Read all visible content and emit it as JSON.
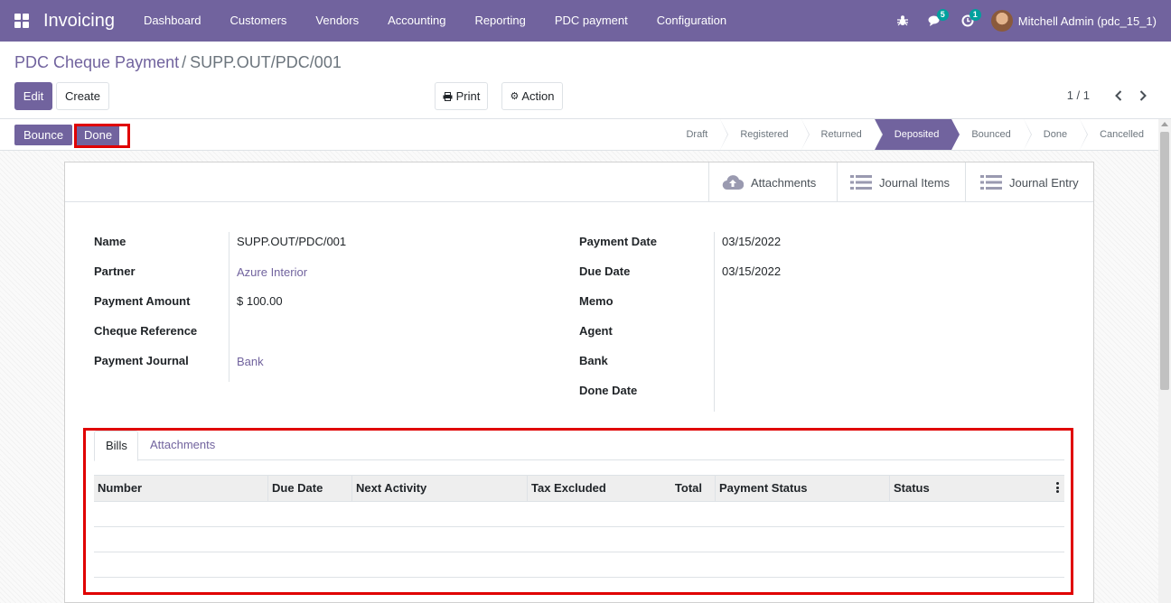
{
  "navbar": {
    "app_name": "Invoicing",
    "menu": [
      "Dashboard",
      "Customers",
      "Vendors",
      "Accounting",
      "Reporting",
      "PDC payment",
      "Configuration"
    ],
    "messages_count": "5",
    "activities_count": "1",
    "user_name": "Mitchell Admin (pdc_15_1)",
    "brand_color": "#71639e"
  },
  "breadcrumb": {
    "parent": "PDC Cheque Payment",
    "separator": "/",
    "current": "SUPP.OUT/PDC/001"
  },
  "toolbar": {
    "edit_label": "Edit",
    "create_label": "Create",
    "print_label": "Print",
    "action_label": "Action",
    "pager": "1 / 1"
  },
  "statusbar": {
    "bounce_label": "Bounce",
    "done_label": "Done",
    "stages": [
      "Draft",
      "Registered",
      "Returned",
      "Deposited",
      "Bounced",
      "Done",
      "Cancelled"
    ],
    "active_stage": "Deposited"
  },
  "smart_buttons": {
    "attachments": "Attachments",
    "journal_items": "Journal Items",
    "journal_entry": "Journal Entry"
  },
  "form": {
    "left": [
      {
        "label": "Name",
        "value": "SUPP.OUT/PDC/001"
      },
      {
        "label": "Partner",
        "value": "Azure Interior"
      },
      {
        "label": "Payment Amount",
        "value": "$ 100.00"
      },
      {
        "label": "Cheque Reference",
        "value": ""
      },
      {
        "label": "Payment Journal",
        "value": "Bank"
      }
    ],
    "right": [
      {
        "label": "Payment Date",
        "value": "03/15/2022"
      },
      {
        "label": "Due Date",
        "value": "03/15/2022"
      },
      {
        "label": "Memo",
        "value": ""
      },
      {
        "label": "Agent",
        "value": ""
      },
      {
        "label": "Bank",
        "value": ""
      },
      {
        "label": "Done Date",
        "value": ""
      }
    ]
  },
  "notebook": {
    "tabs": [
      "Bills",
      "Attachments"
    ],
    "active_tab": "Bills",
    "columns": [
      "Number",
      "Due Date",
      "Next Activity",
      "Tax Excluded",
      "Total",
      "Payment Status",
      "Status"
    ],
    "rows": []
  }
}
